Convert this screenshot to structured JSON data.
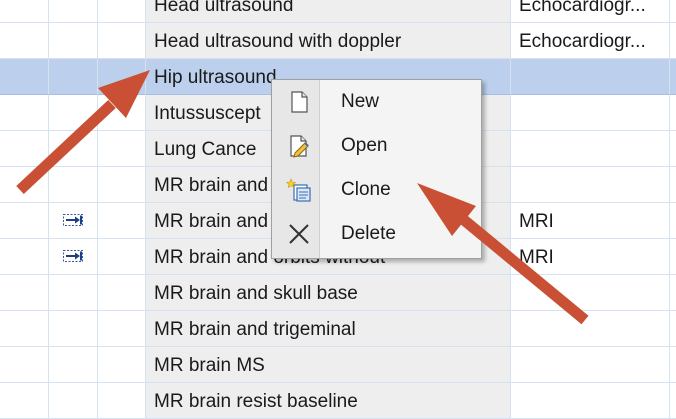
{
  "rows": [
    {
      "name": "Head ultrasound",
      "modality": "Echocardiogr...",
      "icon": ""
    },
    {
      "name": "Head ultrasound with doppler",
      "modality": "Echocardiogr...",
      "icon": ""
    },
    {
      "name": "Hip ultrasound",
      "modality": "",
      "icon": "",
      "selected": true
    },
    {
      "name": "Intussuscept",
      "modality": "",
      "icon": ""
    },
    {
      "name": "Lung Cance",
      "modality": "",
      "icon": ""
    },
    {
      "name": "MR brain and",
      "modality": "",
      "icon": ""
    },
    {
      "name": "MR brain and",
      "modality": "MRI",
      "icon": "linked-arrow-icon"
    },
    {
      "name": "MR brain and orbits without",
      "modality": "MRI",
      "icon": "linked-arrow-icon"
    },
    {
      "name": "MR brain and skull base",
      "modality": "",
      "icon": ""
    },
    {
      "name": "MR brain and trigeminal",
      "modality": "",
      "icon": ""
    },
    {
      "name": "MR brain MS",
      "modality": "",
      "icon": ""
    },
    {
      "name": "MR brain resist baseline",
      "modality": "",
      "icon": ""
    }
  ],
  "context_menu": {
    "items": [
      {
        "label": "New",
        "icon": "new-document-icon"
      },
      {
        "label": "Open",
        "icon": "open-edit-icon"
      },
      {
        "label": "Clone",
        "icon": "clone-icon"
      },
      {
        "label": "Delete",
        "icon": "delete-x-icon"
      }
    ]
  },
  "annotations": {
    "arrow_color": "#c94f35"
  },
  "colors": {
    "selection": "#bcd0ee",
    "name_column_bg": "#eeeeee",
    "grid_line": "#d6e2f0"
  }
}
